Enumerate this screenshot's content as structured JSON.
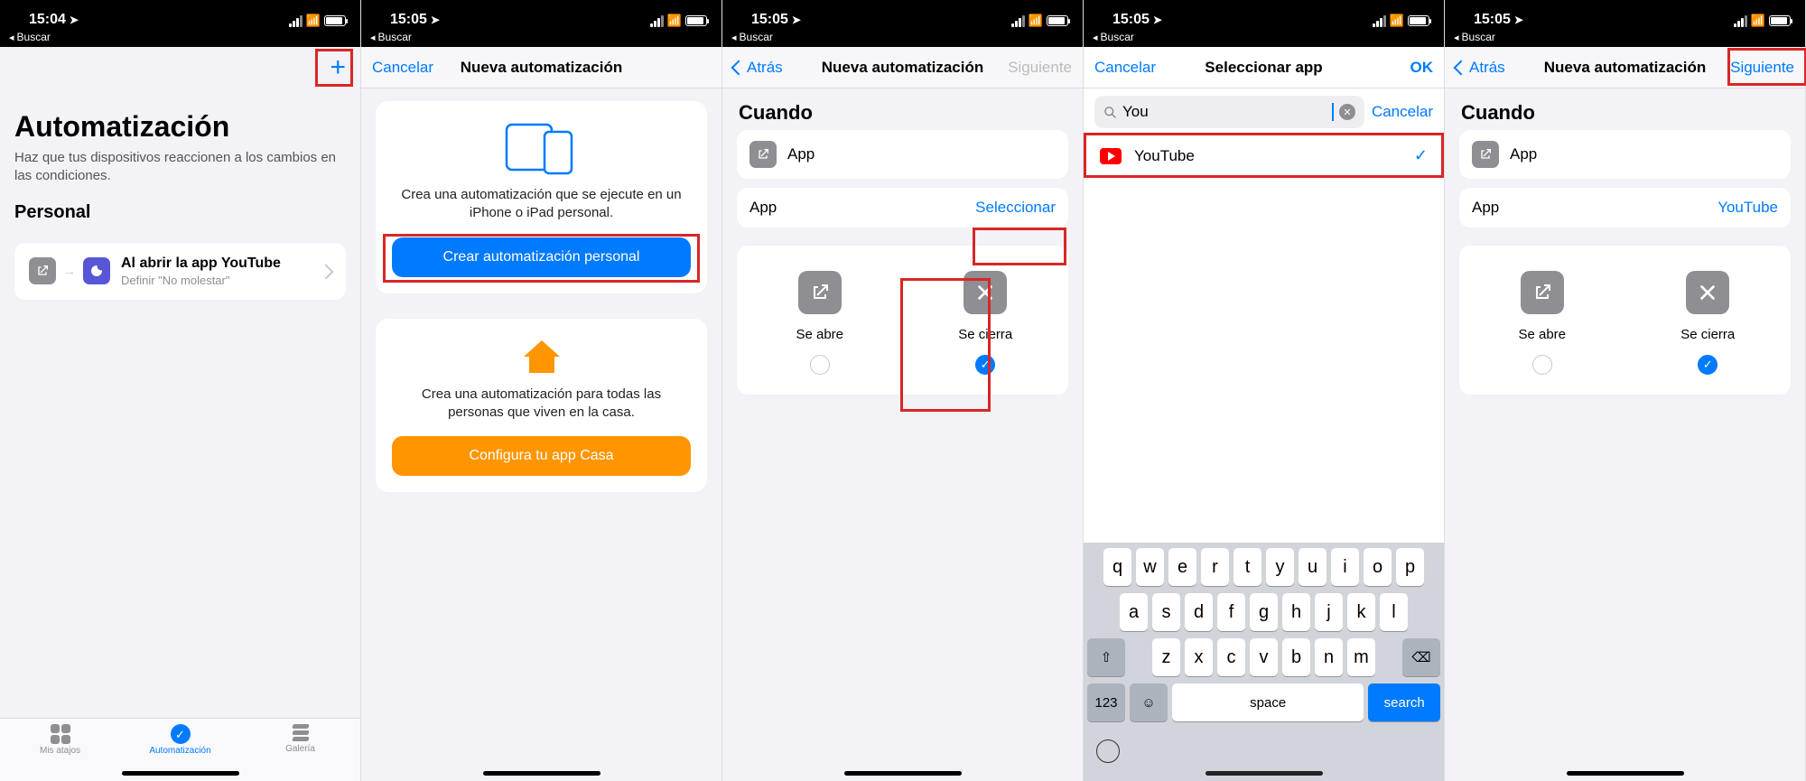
{
  "status": {
    "time1": "15:04",
    "time2": "15:05",
    "back_label": "Buscar"
  },
  "screen1": {
    "title": "Automatización",
    "subtitle": "Haz que tus dispositivos reaccionen a los cambios en las condiciones.",
    "section": "Personal",
    "item_title": "Al abrir la app YouTube",
    "item_sub": "Definir \"No molestar\"",
    "tabs": {
      "shortcuts": "Mis atajos",
      "automation": "Automatización",
      "gallery": "Galería"
    }
  },
  "screen2": {
    "nav_cancel": "Cancelar",
    "nav_title": "Nueva automatización",
    "personal_text": "Crea una automatización que se ejecute en un iPhone o iPad personal.",
    "personal_btn": "Crear automatización personal",
    "home_text": "Crea una automatización para todas las personas que viven en la casa.",
    "home_btn": "Configura tu app Casa"
  },
  "screen3": {
    "nav_back": "Atrás",
    "nav_title": "Nueva automatización",
    "nav_next": "Siguiente",
    "section": "Cuando",
    "row_app": "App",
    "kv_app": "App",
    "kv_select": "Seleccionar",
    "opt_open": "Se abre",
    "opt_close": "Se cierra"
  },
  "screen4": {
    "nav_cancel": "Cancelar",
    "nav_title": "Seleccionar app",
    "nav_ok": "OK",
    "search_value": "You",
    "search_cancel": "Cancelar",
    "result": "YouTube",
    "keys_r1": [
      "q",
      "w",
      "e",
      "r",
      "t",
      "y",
      "u",
      "i",
      "o",
      "p"
    ],
    "keys_r2": [
      "a",
      "s",
      "d",
      "f",
      "g",
      "h",
      "j",
      "k",
      "l"
    ],
    "keys_r3": [
      "z",
      "x",
      "c",
      "v",
      "b",
      "n",
      "m"
    ],
    "key_num": "123",
    "key_space": "space",
    "key_search": "search"
  },
  "screen5": {
    "nav_back": "Atrás",
    "nav_title": "Nueva automatización",
    "nav_next": "Siguiente",
    "section": "Cuando",
    "row_app": "App",
    "kv_app": "App",
    "kv_value": "YouTube",
    "opt_open": "Se abre",
    "opt_close": "Se cierra"
  }
}
